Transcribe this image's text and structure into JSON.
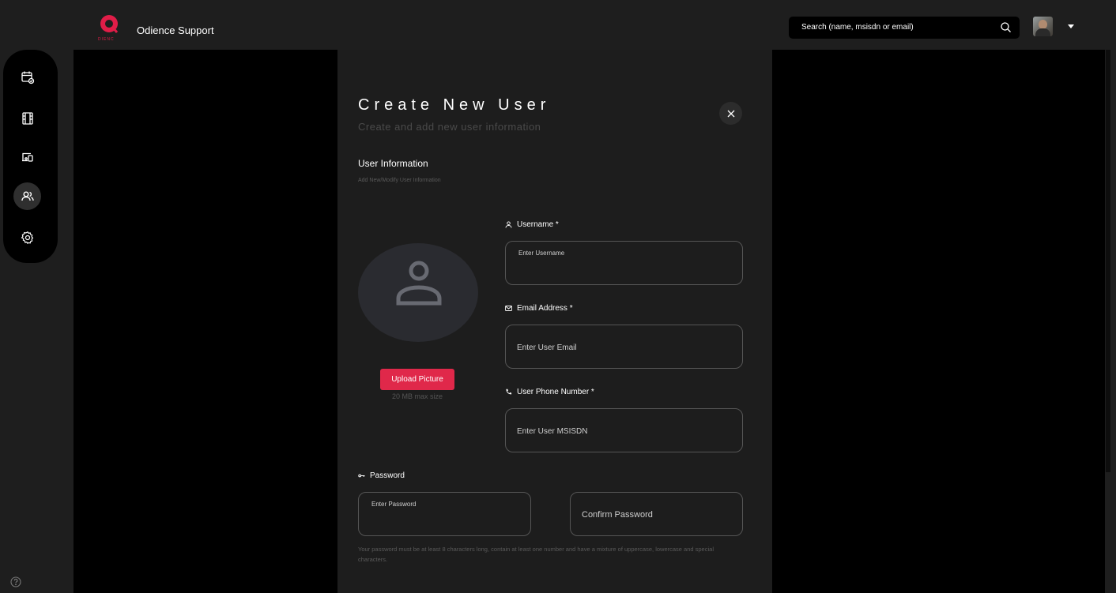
{
  "header": {
    "app_title": "Odience Support",
    "logo_sub": "DIENC",
    "search_placeholder": "Search (name, msisdn or email)"
  },
  "sidebar": {
    "items": [
      {
        "icon": "calendar-check-icon"
      },
      {
        "icon": "film-icon"
      },
      {
        "icon": "devices-icon"
      },
      {
        "icon": "users-icon",
        "active": true
      },
      {
        "icon": "gear-icon"
      }
    ],
    "help_icon": "help-icon"
  },
  "modal": {
    "title": "Create New User",
    "subtitle": "Create and add new user information",
    "section_title": "User Information",
    "section_subtitle": "Add New/Modify User Information",
    "upload_button": "Upload Picture",
    "upload_note": "20 MB max size",
    "username": {
      "label": "Username *",
      "placeholder": "Enter Username"
    },
    "email": {
      "label": "Email Address *",
      "placeholder": "Enter User Email"
    },
    "phone": {
      "label": "User Phone Number *",
      "placeholder": "Enter User MSISDN"
    },
    "password": {
      "label": "Password",
      "placeholder": "Enter Password",
      "confirm_placeholder": "Confirm Password",
      "help": "Your password must be at least 8 characters long, contain at least one number and have a mixture of uppercase, lowercase and special characters."
    }
  },
  "colors": {
    "accent": "#e0284a",
    "panel": "#1d1d1d",
    "rail": "#1e1e1e"
  }
}
